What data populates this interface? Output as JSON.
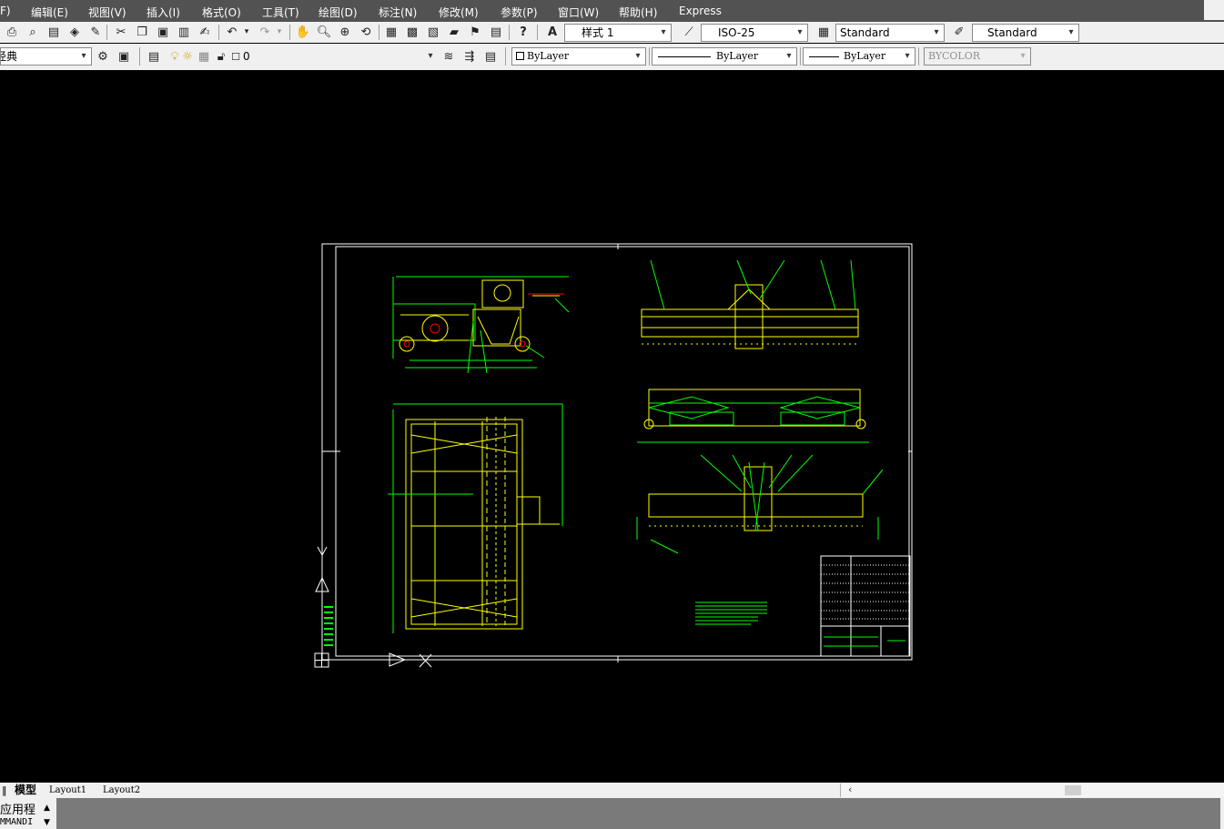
{
  "menu": [
    {
      "label": "F)"
    },
    {
      "label": "编辑(E)"
    },
    {
      "label": "视图(V)"
    },
    {
      "label": "插入(I)"
    },
    {
      "label": "格式(O)"
    },
    {
      "label": "工具(T)"
    },
    {
      "label": "绘图(D)"
    },
    {
      "label": "标注(N)"
    },
    {
      "label": "修改(M)"
    },
    {
      "label": "参数(P)"
    },
    {
      "label": "窗口(W)"
    },
    {
      "label": "帮助(H)"
    },
    {
      "label": "Express"
    }
  ],
  "styles_toolbar": {
    "text_style": "样式 1",
    "dim_style": "ISO-25",
    "table_style": "Standard",
    "multileader_style": "Standard"
  },
  "layers_toolbar": {
    "workspace": "经典",
    "layer": "0"
  },
  "properties_toolbar": {
    "color": "ByLayer",
    "linetype": "ByLayer",
    "lineweight": "ByLayer",
    "plotstyle": "BYCOLOR"
  },
  "tabs": {
    "model": "模型",
    "layout1": "Layout1",
    "layout2": "Layout2"
  },
  "command": {
    "label": "应用程",
    "line": "MMANDI"
  },
  "colors": {
    "drawing_bg": "#000000",
    "geometry_yellow": "#ffff00",
    "geometry_green": "#00ff00",
    "frame": "#ffffff",
    "hidden_red": "#ff0000",
    "menubar": "#525252",
    "toolbar": "#f0f0f0"
  }
}
